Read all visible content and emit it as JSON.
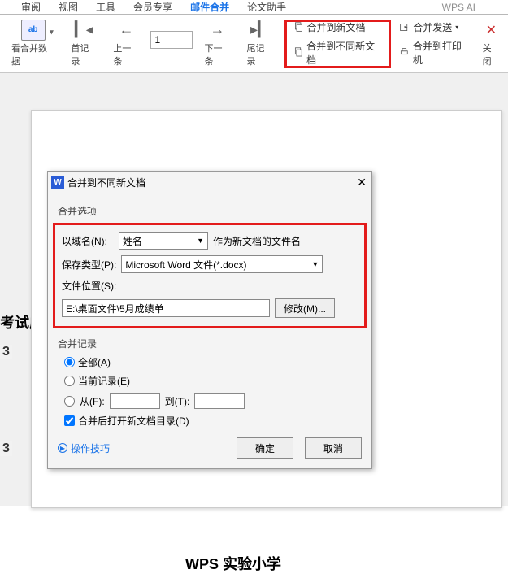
{
  "menu": {
    "items": [
      "审阅",
      "视图",
      "工具",
      "会员专享",
      "邮件合并",
      "论文助手"
    ],
    "active_index": 4,
    "wpsai": "WPS AI"
  },
  "ribbon": {
    "view_data": "看合并数据",
    "first_record": "首记录",
    "prev": "上一条",
    "page_value": "1",
    "next": "下一条",
    "last_record": "尾记录",
    "merge_new": "合并到新文档",
    "merge_diff_new": "合并到不同新文档",
    "merge_send": "合并发送",
    "merge_print": "合并到打印机",
    "close": "关闭"
  },
  "doc": {
    "side_text": "考试成绩",
    "side_num1": "3",
    "side_num2": "3",
    "title": "WPS 实验小学"
  },
  "dialog": {
    "title": "合并到不同新文档",
    "section_options": "合并选项",
    "field_label": "以域名(N):",
    "field_value": "姓名",
    "filename_hint": "作为新文档的文件名",
    "save_type_label": "保存类型(P):",
    "save_type_value": "Microsoft Word 文件(*.docx)",
    "file_loc_label": "文件位置(S):",
    "file_loc_value": "E:\\桌面文件\\5月成绩单",
    "modify_btn": "修改(M)...",
    "section_records": "合并记录",
    "opt_all": "全部(A)",
    "opt_current": "当前记录(E)",
    "opt_from": "从(F):",
    "opt_to": "到(T):",
    "chk_open": "合并后打开新文档目录(D)",
    "tips": "操作技巧",
    "ok": "确定",
    "cancel": "取消"
  }
}
